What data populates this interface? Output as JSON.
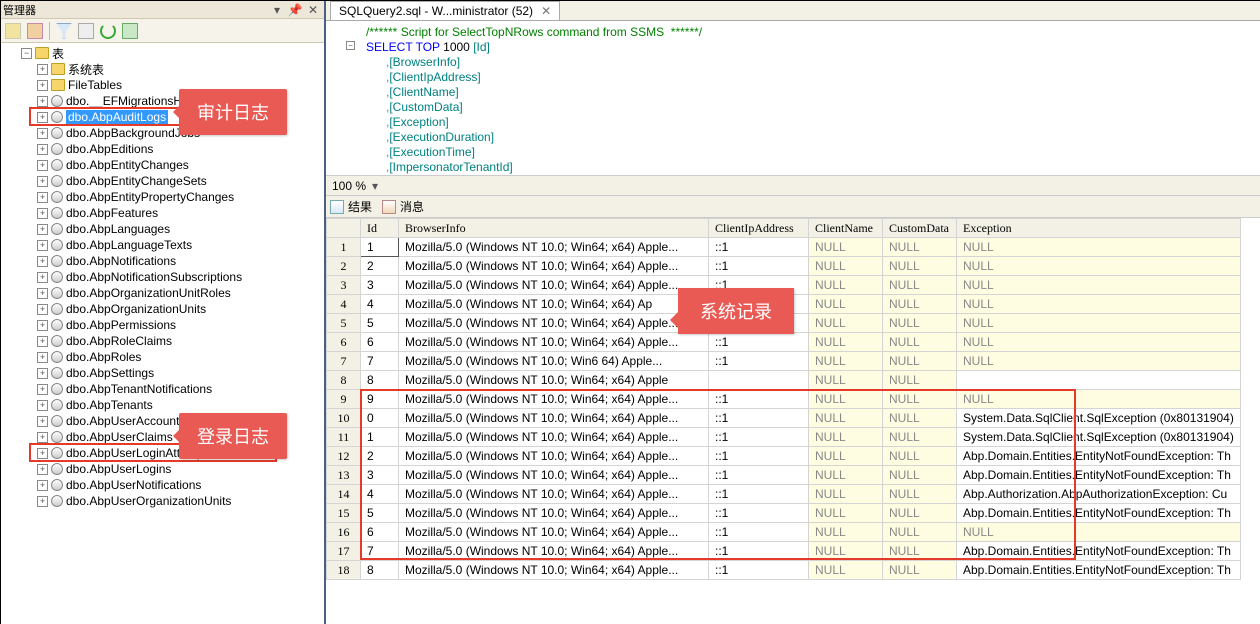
{
  "leftPane": {
    "title": "管理器",
    "toolbarIcons": [
      "connect-icon",
      "disconnect-icon",
      "sep",
      "filter-icon",
      "nofilter-icon",
      "refresh-icon",
      "script-icon"
    ],
    "topNode": "表",
    "systemFolder": "系统表",
    "fileTables": "FileTables",
    "tables": [
      "dbo.__EFMigrationsHistory",
      "dbo.AbpAuditLogs",
      "dbo.AbpBackgroundJobs",
      "dbo.AbpEditions",
      "dbo.AbpEntityChanges",
      "dbo.AbpEntityChangeSets",
      "dbo.AbpEntityPropertyChanges",
      "dbo.AbpFeatures",
      "dbo.AbpLanguages",
      "dbo.AbpLanguageTexts",
      "dbo.AbpNotifications",
      "dbo.AbpNotificationSubscriptions",
      "dbo.AbpOrganizationUnitRoles",
      "dbo.AbpOrganizationUnits",
      "dbo.AbpPermissions",
      "dbo.AbpRoleClaims",
      "dbo.AbpRoles",
      "dbo.AbpSettings",
      "dbo.AbpTenantNotifications",
      "dbo.AbpTenants",
      "dbo.AbpUserAccounts",
      "dbo.AbpUserClaims",
      "dbo.AbpUserLoginAttempts",
      "dbo.AbpUserLogins",
      "dbo.AbpUserNotifications",
      "dbo.AbpUserOrganizationUnits"
    ],
    "calloutAudit": "审计日志",
    "calloutLogin": "登录日志"
  },
  "rightPane": {
    "tabLabel": "SQLQuery2.sql - W...ministrator (52)",
    "sql": {
      "l1": "/****** Script for SelectTopNRows command from SSMS  ******/",
      "l2a": "SELECT",
      "l2b": " TOP ",
      "l2c": "1000 ",
      "l2d": "[Id]",
      "l3": "      ,",
      "c3": "[BrowserInfo]",
      "l4": "      ,",
      "c4": "[ClientIpAddress]",
      "l5": "      ,",
      "c5": "[ClientName]",
      "l6": "      ,",
      "c6": "[CustomData]",
      "l7": "      ,",
      "c7": "[Exception]",
      "l8": "      ,",
      "c8": "[ExecutionDuration]",
      "l9": "      ,",
      "c9": "[ExecutionTime]",
      "l10": "      ,",
      "c10": "[ImpersonatorTenantId]"
    },
    "zoom": "100 %",
    "resultsTab": "结果",
    "messagesTab": "消息",
    "calloutSystem": "系统记录",
    "columns": [
      "",
      "Id",
      "BrowserInfo",
      "ClientIpAddress",
      "ClientName",
      "CustomData",
      "Exception"
    ],
    "browserText": "Mozilla/5.0 (Windows NT 10.0; Win64; x64) Apple...",
    "browserTextShort1": "Mozilla/5.0 (Windows NT 10.0; Win64; x64) Ap",
    "browserTextShort2": "Mozilla/5.0 (Windows NT 10.0; Win6    64) Apple...",
    "browserTextShort3": "Mozilla/5.0 (Windows NT 10.0; Win64; x64) Apple",
    "ip": "::1",
    "null": "NULL",
    "exc_sql": "System.Data.SqlClient.SqlException (0x80131904)",
    "exc_ent": "Abp.Domain.Entities.EntityNotFoundException: Th",
    "exc_auth": "Abp.Authorization.AbpAuthorizationException: Cu",
    "rows": [
      {
        "n": 1,
        "id": "1",
        "ex": "NULL",
        "hl": true
      },
      {
        "n": 2,
        "id": "2",
        "ex": "NULL"
      },
      {
        "n": 3,
        "id": "3",
        "ex": "NULL"
      },
      {
        "n": 4,
        "id": "4",
        "ex": "NULL",
        "b": "s1"
      },
      {
        "n": 5,
        "id": "5",
        "ex": "NULL"
      },
      {
        "n": 6,
        "id": "6",
        "ex": "NULL"
      },
      {
        "n": 7,
        "id": "7",
        "ex": "NULL",
        "b": "s2"
      },
      {
        "n": 8,
        "id": "8",
        "ex": "",
        "b": "s3",
        "noip": true
      },
      {
        "n": 9,
        "id": "9",
        "ex": "NULL"
      },
      {
        "n": 10,
        "id": "0",
        "ex": "exc_sql"
      },
      {
        "n": 11,
        "id": "1",
        "ex": "exc_sql"
      },
      {
        "n": 12,
        "id": "2",
        "ex": "exc_ent"
      },
      {
        "n": 13,
        "id": "3",
        "ex": "exc_ent"
      },
      {
        "n": 14,
        "id": "4",
        "ex": "exc_auth"
      },
      {
        "n": 15,
        "id": "5",
        "ex": "exc_ent"
      },
      {
        "n": 16,
        "id": "6",
        "ex": "NULL"
      },
      {
        "n": 17,
        "id": "7",
        "ex": "exc_ent"
      },
      {
        "n": 18,
        "id": "8",
        "ex": "exc_ent"
      }
    ]
  }
}
